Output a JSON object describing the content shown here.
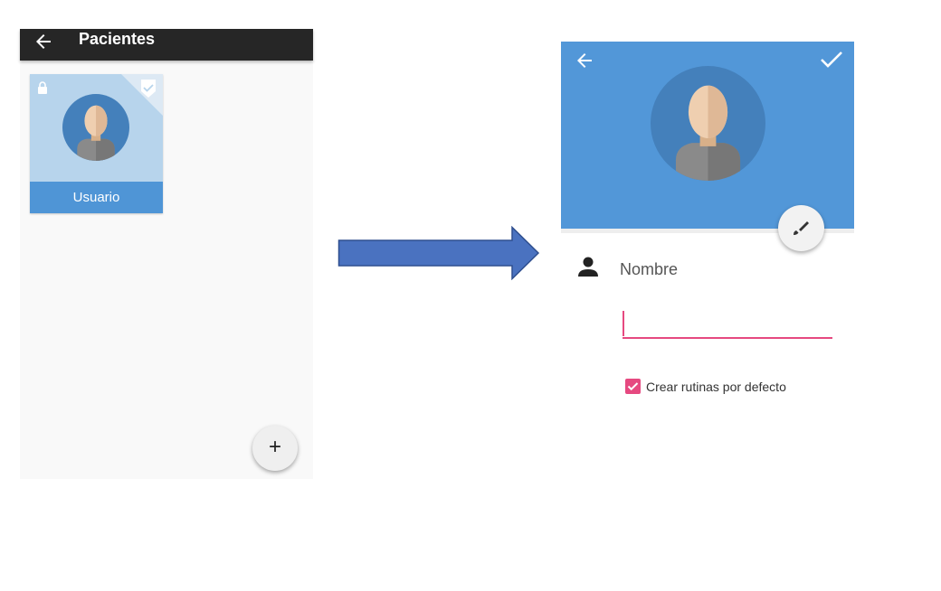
{
  "left_screen": {
    "title": "Pacientes",
    "patients": [
      {
        "name": "Usuario",
        "locked": true,
        "selected": true
      }
    ],
    "add_button_symbol": "+"
  },
  "right_screen": {
    "name_label": "Nombre",
    "name_value": "",
    "create_routines_label": "Crear rutinas por defecto",
    "create_routines_checked": true
  },
  "colors": {
    "dark_appbar": "#262626",
    "header_blue": "#5297d8",
    "card_blue": "#b7d4ec",
    "label_blue": "#4f95d6",
    "accent_pink": "#e64980",
    "arrow_fill": "#4a72c0",
    "arrow_stroke": "#2f4f8f"
  },
  "icons": {
    "back": "arrow-left-icon",
    "done": "check-icon",
    "lock": "lock-icon",
    "selected": "checkmark-badge-icon",
    "avatar": "avatar-icon",
    "add": "plus-icon",
    "edit": "brush-icon",
    "person": "person-icon",
    "transition": "right-arrow-icon"
  }
}
